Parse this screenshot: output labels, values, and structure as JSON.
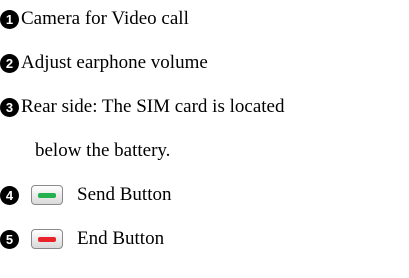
{
  "items": [
    {
      "number": "1",
      "text": "Camera for Video call"
    },
    {
      "number": "2",
      "text": "Adjust earphone volume"
    },
    {
      "number": "3",
      "text": "Rear side: The SIM card is located",
      "continuation": "below the battery."
    },
    {
      "number": "4",
      "text": "Send Button",
      "key_icon": "send-key-icon",
      "key_color": "#22b14c"
    },
    {
      "number": "5",
      "text": "End Button",
      "key_icon": "end-key-icon",
      "key_color": "#e8242a"
    }
  ]
}
